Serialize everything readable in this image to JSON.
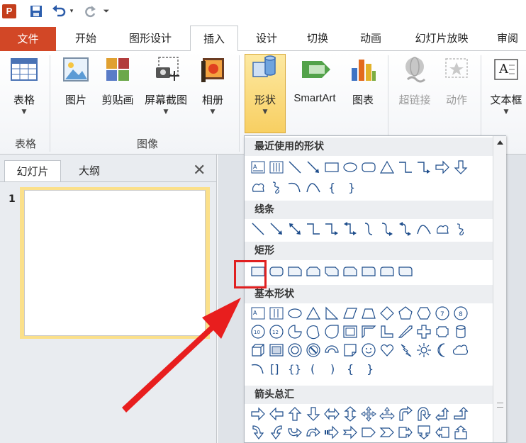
{
  "quick_access": {
    "app_letter": "P",
    "items": [
      "save-icon",
      "undo-icon",
      "redo-icon",
      "customize-icon"
    ]
  },
  "tabs": [
    "文件",
    "开始",
    "图形设计",
    "插入",
    "设计",
    "切换",
    "动画",
    "幻灯片放映",
    "审阅"
  ],
  "active_tab": "插入",
  "ribbon": {
    "table_label": "表格",
    "table_group": "表格",
    "picture_label": "图片",
    "clipart_label": "剪贴画",
    "screenshot_label": "屏幕截图",
    "album_label": "相册",
    "images_group": "图像",
    "shapes_label": "形状",
    "smartart_label": "SmartArt",
    "chart_label": "图表",
    "hyperlink_label": "超链接",
    "action_label": "动作",
    "textbox_label": "文本框"
  },
  "left_pane": {
    "tab_slides": "幻灯片",
    "tab_outline": "大纲",
    "close_glyph": "✕",
    "slide_number": "1"
  },
  "gallery": {
    "sections": {
      "recent": "最近使用的形状",
      "lines": "线条",
      "rectangles": "矩形",
      "basic": "基本形状",
      "arrows": "箭头总汇"
    }
  },
  "colors": {
    "file_tab": "#d24726",
    "accent_blue": "#2a5aa8",
    "highlight": "#f8cf62",
    "annotation_red": "#e02020"
  }
}
